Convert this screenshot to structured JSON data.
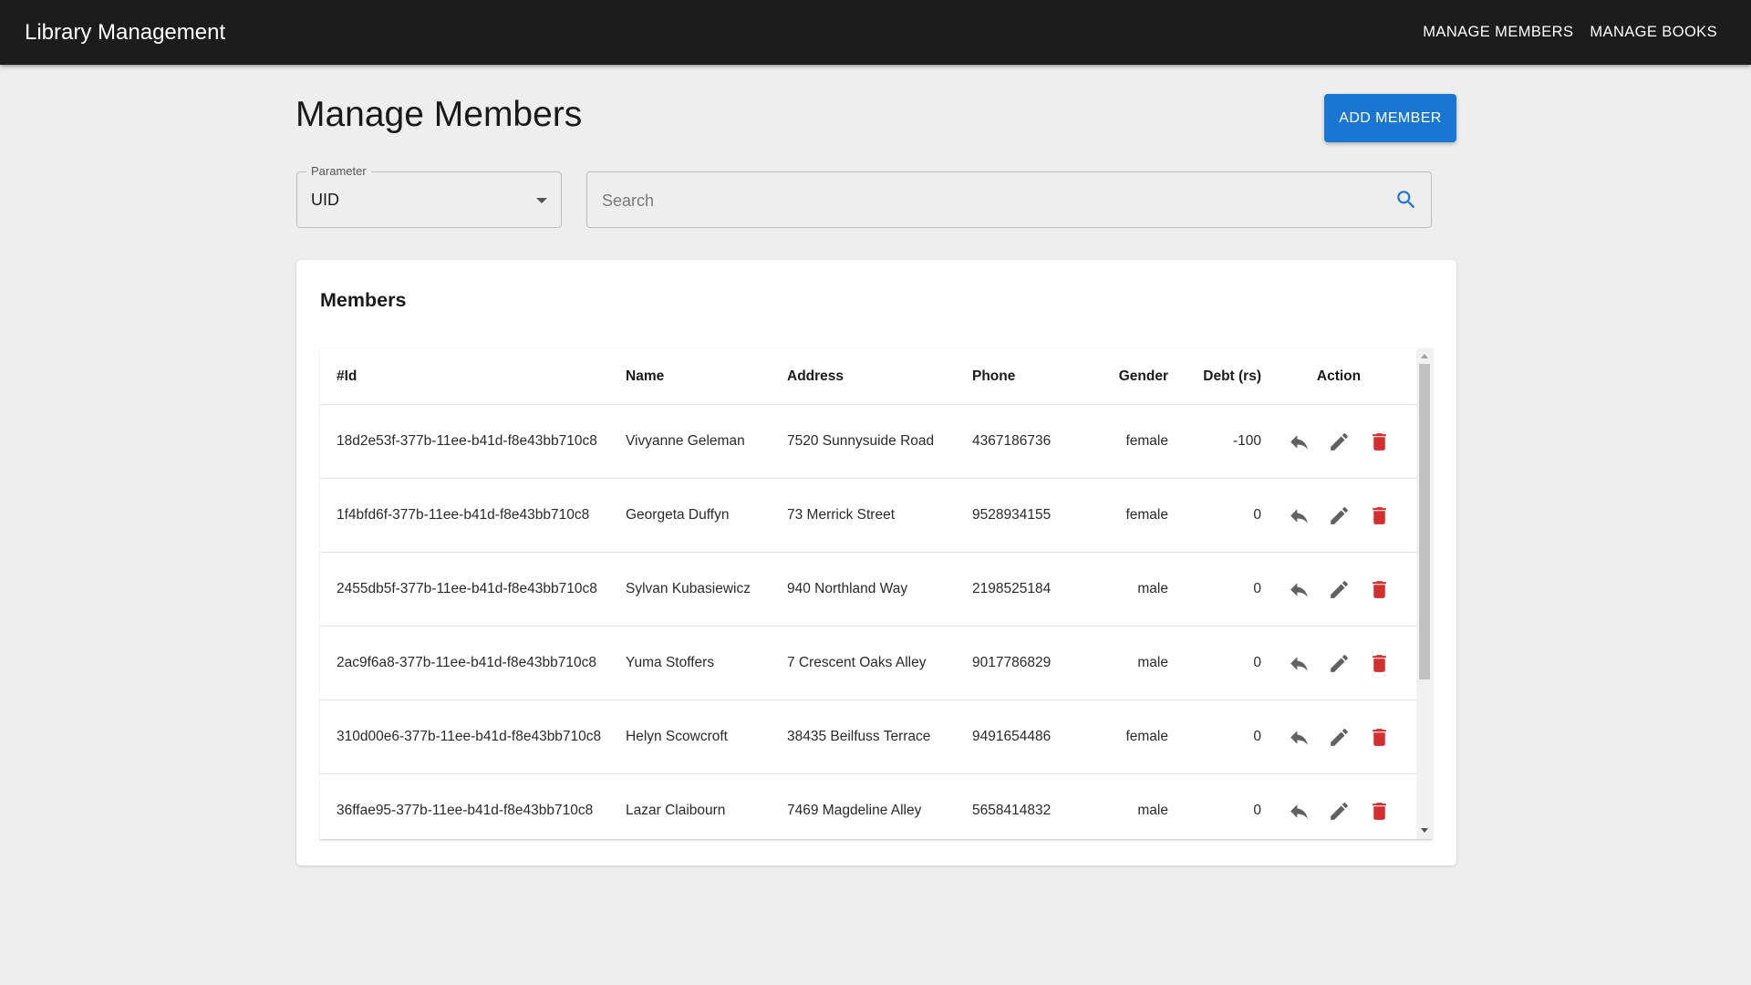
{
  "app": {
    "title": "Library Management"
  },
  "nav": {
    "members": "Manage Members",
    "books": "Manage Books"
  },
  "page": {
    "title": "Manage Members",
    "add_button": "Add Member"
  },
  "filter": {
    "label": "Parameter",
    "value": "UID"
  },
  "search": {
    "placeholder": "Search",
    "value": ""
  },
  "table": {
    "title": "Members",
    "headers": {
      "id": "#Id",
      "name": "Name",
      "address": "Address",
      "phone": "Phone",
      "gender": "Gender",
      "debt": "Debt (rs)",
      "action": "Action"
    },
    "rows": [
      {
        "id": "18d2e53f-377b-11ee-b41d-f8e43bb710c8",
        "name": "Vivyanne Geleman",
        "address": "7520 Sunnysuide Road",
        "phone": "4367186736",
        "gender": "female",
        "debt": "-100"
      },
      {
        "id": "1f4bfd6f-377b-11ee-b41d-f8e43bb710c8",
        "name": "Georgeta Duffyn",
        "address": "73 Merrick Street",
        "phone": "9528934155",
        "gender": "female",
        "debt": "0"
      },
      {
        "id": "2455db5f-377b-11ee-b41d-f8e43bb710c8",
        "name": "Sylvan Kubasiewicz",
        "address": "940 Northland Way",
        "phone": "2198525184",
        "gender": "male",
        "debt": "0"
      },
      {
        "id": "2ac9f6a8-377b-11ee-b41d-f8e43bb710c8",
        "name": "Yuma Stoffers",
        "address": "7 Crescent Oaks Alley",
        "phone": "9017786829",
        "gender": "male",
        "debt": "0"
      },
      {
        "id": "310d00e6-377b-11ee-b41d-f8e43bb710c8",
        "name": "Helyn Scowcroft",
        "address": "38435 Beilfuss Terrace",
        "phone": "9491654486",
        "gender": "female",
        "debt": "0"
      },
      {
        "id": "36ffae95-377b-11ee-b41d-f8e43bb710c8",
        "name": "Lazar Claibourn",
        "address": "7469 Magdeline Alley",
        "phone": "5658414832",
        "gender": "male",
        "debt": "0"
      }
    ]
  },
  "icons": {
    "return": "reply-icon",
    "edit": "pencil-icon",
    "delete": "trash-icon",
    "search": "search-icon",
    "dropdown": "caret-down-icon"
  },
  "colors": {
    "appbar": "#1c1c1c",
    "accent": "#1976d2",
    "delete": "#d32f2f",
    "icon_gray": "#616161",
    "background": "#eeeeee"
  }
}
